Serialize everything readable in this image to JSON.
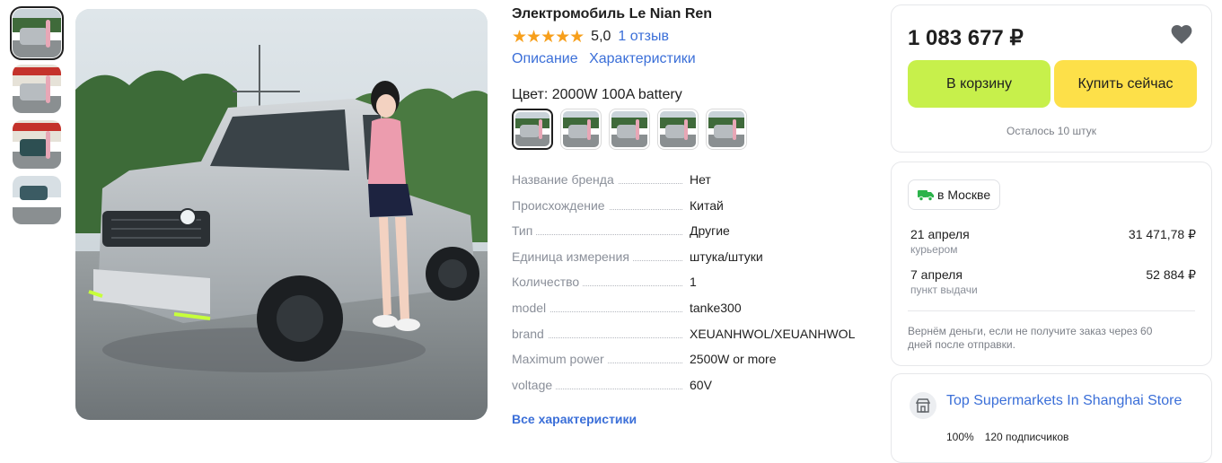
{
  "product": {
    "title": "Электромобиль Le Nian Ren",
    "stars": "★★★★★",
    "rating": "5,0",
    "reviews": "1 отзыв",
    "links": [
      "Описание",
      "Характеристики"
    ],
    "color_label": "Цвет: 2000W 100A battery",
    "thumbnail_count": 4,
    "swatch_count": 5
  },
  "specs": [
    {
      "name": "Название бренда",
      "value": "Нет"
    },
    {
      "name": "Происхождение",
      "value": "Китай"
    },
    {
      "name": "Тип",
      "value": "Другие"
    },
    {
      "name": "Единица измерения",
      "value": "штука/штуки"
    },
    {
      "name": "Количество",
      "value": "1"
    },
    {
      "name": "model",
      "value": "tanke300"
    },
    {
      "name": "brand",
      "value": "XEUANHWOL/XEUANHWOL"
    },
    {
      "name": "Maximum power",
      "value": "2500W or more"
    },
    {
      "name": "voltage",
      "value": "60V"
    }
  ],
  "all_specs_link": "Все характеристики",
  "buy": {
    "price": "1 083 677 ₽",
    "cart_label": "В корзину",
    "buy_now_label": "Купить сейчас",
    "stock": "Осталось 10 штук"
  },
  "delivery": {
    "city": "в Москве",
    "options": [
      {
        "date": "21 апреля",
        "type": "курьером",
        "price": "31 471,78 ₽"
      },
      {
        "date": "7 апреля",
        "type": "пункт выдачи",
        "price": "52 884 ₽"
      }
    ],
    "refund": "Вернём деньги, если не получите заказ через 60 дней после отправки."
  },
  "store": {
    "name": "Top Supermarkets In Shanghai Store",
    "rating": "100%",
    "subscribers": "120 подписчиков"
  },
  "colors": {
    "link": "#3b6fd8",
    "star": "#f79f1b",
    "cart_button": "#c7f04b",
    "buy_now_button": "#fde049",
    "truck_icon": "#2bb34a"
  }
}
